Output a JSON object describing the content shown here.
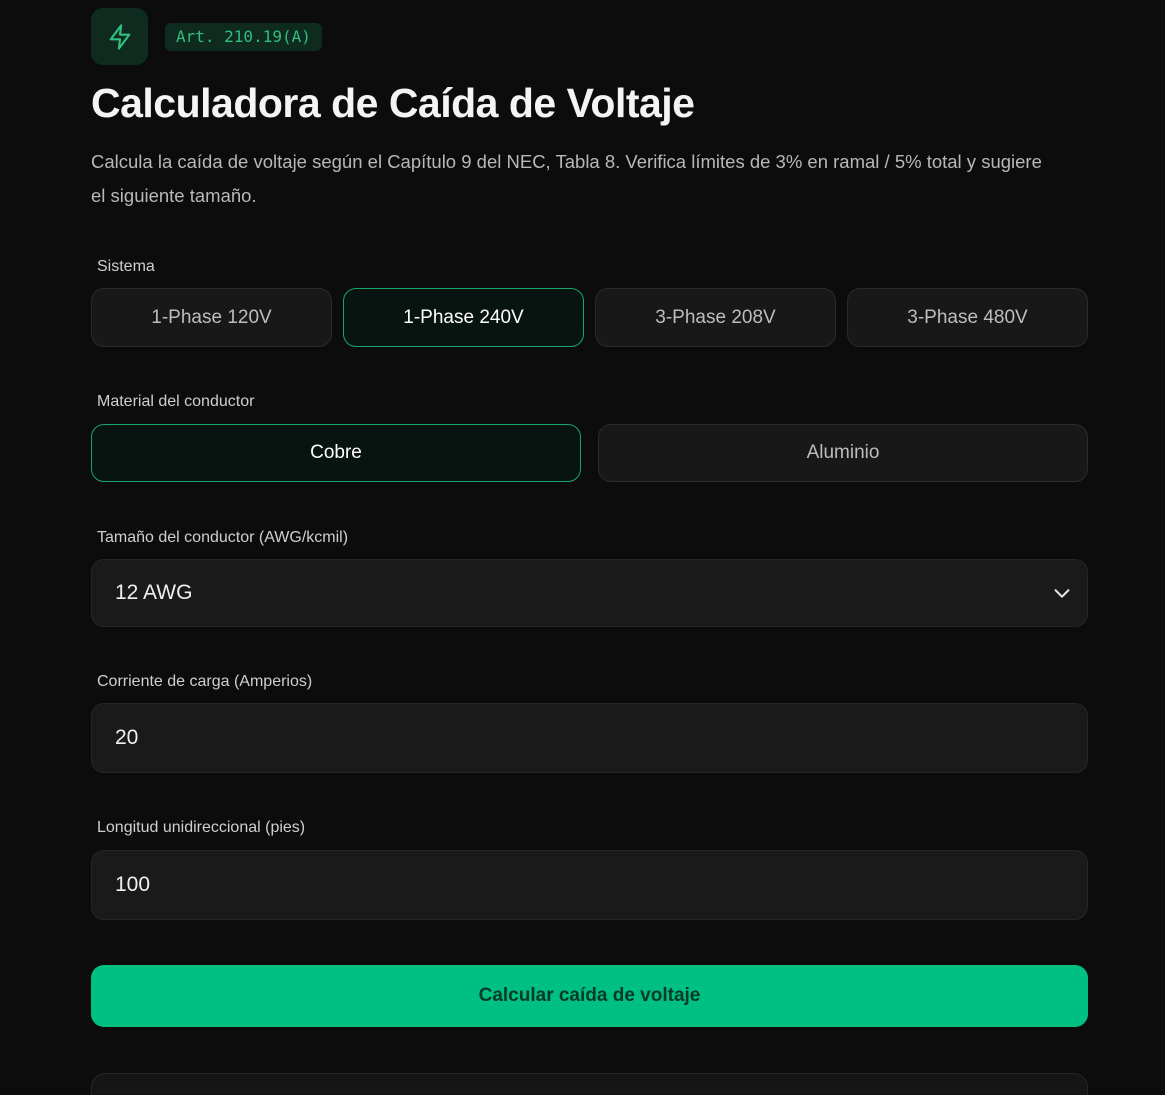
{
  "header": {
    "logo_icon": "lightning-bolt-icon",
    "badge": "Art. 210.19(A)",
    "title": "Calculadora de Caída de Voltaje",
    "subtitle": "Calcula la caída de voltaje según el Capítulo 9 del NEC, Tabla 8. Verifica límites de 3% en ramal / 5% total y sugiere el siguiente tamaño."
  },
  "system": {
    "label": "Sistema",
    "options": [
      "1-Phase 120V",
      "1-Phase 240V",
      "3-Phase 208V",
      "3-Phase 480V"
    ],
    "selected": "1-Phase 240V"
  },
  "material": {
    "label": "Material del conductor",
    "options": [
      "Cobre",
      "Aluminio"
    ],
    "selected": "Cobre"
  },
  "conductor_size": {
    "label": "Tamaño del conductor (AWG/kcmil)",
    "value": "12 AWG",
    "icon": "chevron-down-icon"
  },
  "current": {
    "label": "Corriente de carga (Amperios)",
    "value": "20"
  },
  "length": {
    "label": "Longitud unidireccional (pies)",
    "value": "100"
  },
  "calculate_button": "Calcular caída de voltaje",
  "colors": {
    "accent": "#00bf83",
    "active_border": "#17a56a",
    "background": "#0c0c0c",
    "badge_text": "#2fbf7f"
  }
}
